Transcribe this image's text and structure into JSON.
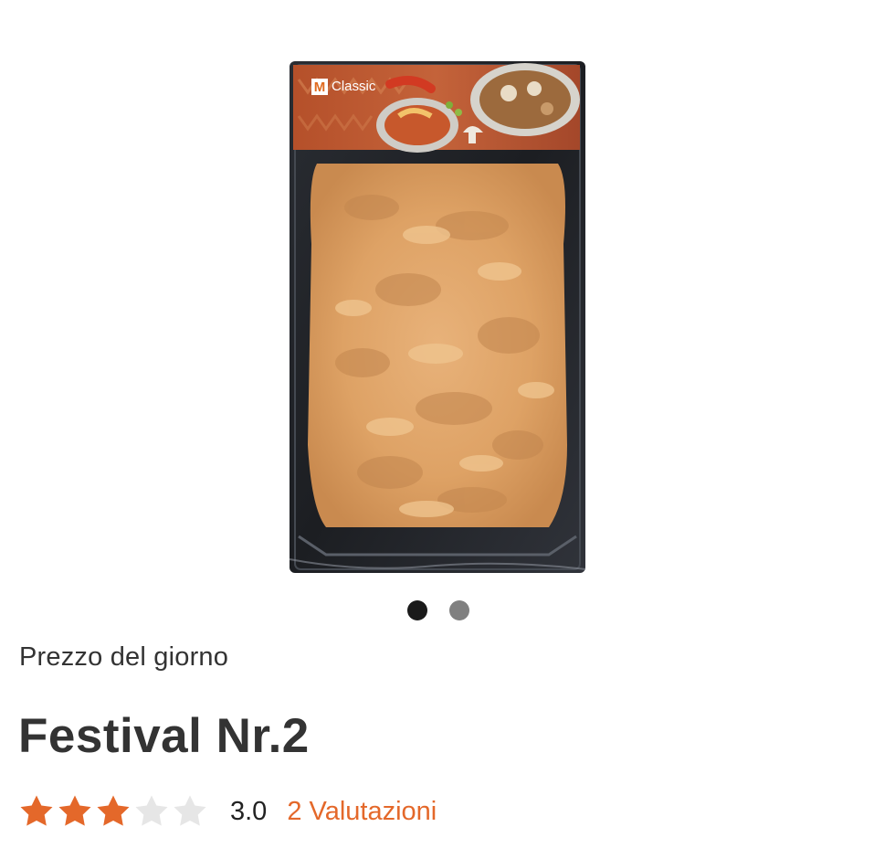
{
  "product": {
    "badge": "Prezzo del giorno",
    "title": "Festival Nr.2",
    "image": {
      "brand_label": "Classic",
      "brand_logo_letter": "M",
      "alt": "Festival Nr.2"
    }
  },
  "carousel": {
    "total": 2,
    "active_index": 0
  },
  "rating": {
    "stars_filled": 3,
    "stars_total": 5,
    "value_text": "3.0",
    "reviews_link": "2 Valutazioni"
  },
  "colors": {
    "accent": "#e4682a",
    "star_filled": "#e4682a",
    "star_empty": "#e6e6e6",
    "text": "#333333",
    "dot_active": "#1a1a1a",
    "dot_inactive": "#808080"
  }
}
